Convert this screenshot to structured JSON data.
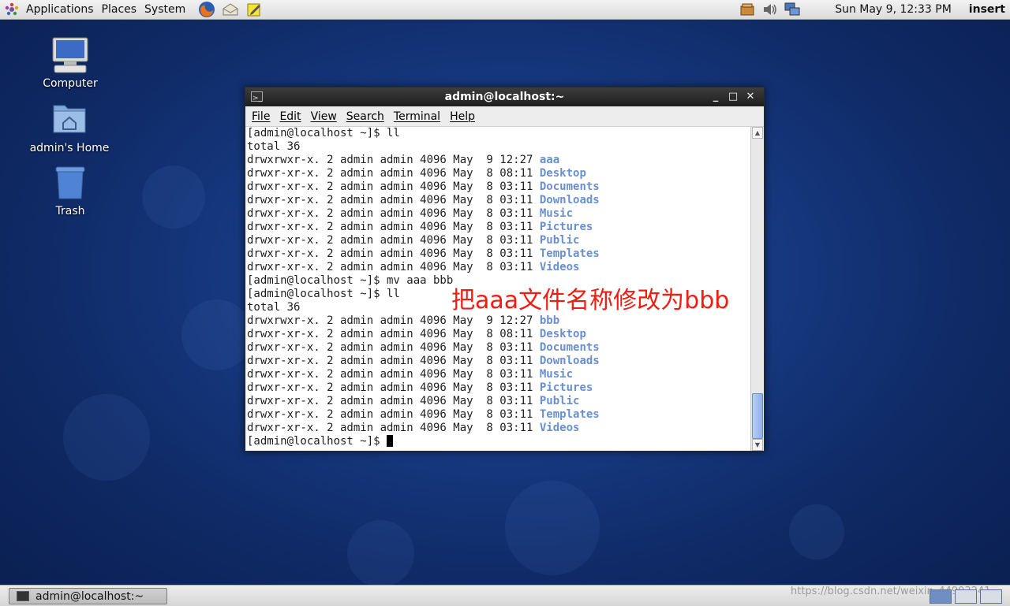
{
  "top_panel": {
    "menus": [
      "Applications",
      "Places",
      "System"
    ],
    "clock": "Sun May  9, 12:33 PM",
    "keyboard_mode": "insert"
  },
  "desktop": {
    "icons": [
      {
        "label": "Computer",
        "icon": "computer-icon"
      },
      {
        "label": "admin's Home",
        "icon": "home-folder-icon"
      },
      {
        "label": "Trash",
        "icon": "trash-icon"
      }
    ]
  },
  "terminal": {
    "title": "admin@localhost:~",
    "menu": [
      "File",
      "Edit",
      "View",
      "Search",
      "Terminal",
      "Help"
    ],
    "lines": [
      {
        "text": "[admin@localhost ~]$ ll",
        "dir": ""
      },
      {
        "text": "total 36",
        "dir": ""
      },
      {
        "text": "drwxrwxr-x. 2 admin admin 4096 May  9 12:27 ",
        "dir": "aaa"
      },
      {
        "text": "drwxr-xr-x. 2 admin admin 4096 May  8 08:11 ",
        "dir": "Desktop"
      },
      {
        "text": "drwxr-xr-x. 2 admin admin 4096 May  8 03:11 ",
        "dir": "Documents"
      },
      {
        "text": "drwxr-xr-x. 2 admin admin 4096 May  8 03:11 ",
        "dir": "Downloads"
      },
      {
        "text": "drwxr-xr-x. 2 admin admin 4096 May  8 03:11 ",
        "dir": "Music"
      },
      {
        "text": "drwxr-xr-x. 2 admin admin 4096 May  8 03:11 ",
        "dir": "Pictures"
      },
      {
        "text": "drwxr-xr-x. 2 admin admin 4096 May  8 03:11 ",
        "dir": "Public"
      },
      {
        "text": "drwxr-xr-x. 2 admin admin 4096 May  8 03:11 ",
        "dir": "Templates"
      },
      {
        "text": "drwxr-xr-x. 2 admin admin 4096 May  8 03:11 ",
        "dir": "Videos"
      },
      {
        "text": "[admin@localhost ~]$ mv aaa bbb",
        "dir": ""
      },
      {
        "text": "[admin@localhost ~]$ ll",
        "dir": ""
      },
      {
        "text": "total 36",
        "dir": ""
      },
      {
        "text": "drwxrwxr-x. 2 admin admin 4096 May  9 12:27 ",
        "dir": "bbb"
      },
      {
        "text": "drwxr-xr-x. 2 admin admin 4096 May  8 08:11 ",
        "dir": "Desktop"
      },
      {
        "text": "drwxr-xr-x. 2 admin admin 4096 May  8 03:11 ",
        "dir": "Documents"
      },
      {
        "text": "drwxr-xr-x. 2 admin admin 4096 May  8 03:11 ",
        "dir": "Downloads"
      },
      {
        "text": "drwxr-xr-x. 2 admin admin 4096 May  8 03:11 ",
        "dir": "Music"
      },
      {
        "text": "drwxr-xr-x. 2 admin admin 4096 May  8 03:11 ",
        "dir": "Pictures"
      },
      {
        "text": "drwxr-xr-x. 2 admin admin 4096 May  8 03:11 ",
        "dir": "Public"
      },
      {
        "text": "drwxr-xr-x. 2 admin admin 4096 May  8 03:11 ",
        "dir": "Templates"
      },
      {
        "text": "drwxr-xr-x. 2 admin admin 4096 May  8 03:11 ",
        "dir": "Videos"
      }
    ],
    "prompt": "[admin@localhost ~]$ ",
    "annotation": "把aaa文件名称修改为bbb",
    "colors": {
      "directory": "#6a8fd0",
      "annotation": "#f01d12"
    }
  },
  "bottom_panel": {
    "task_label": "admin@localhost:~",
    "watermark": "https://blog.csdn.net/weixin_44903241"
  }
}
